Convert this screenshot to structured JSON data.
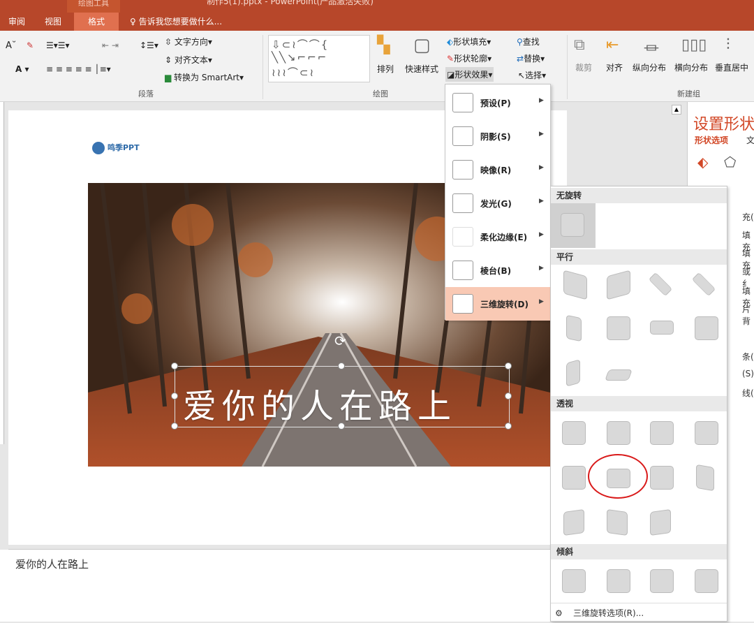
{
  "titlebar": {
    "context_tab": "绘图工具",
    "document": "制作5(1).pptx - PowerPoint(产品激活失败)"
  },
  "tabs": [
    {
      "label": "审阅"
    },
    {
      "label": "视图"
    },
    {
      "label": "格式"
    }
  ],
  "tell_me": "告诉我您想要做什么...",
  "ribbon": {
    "text_direction": "文字方向",
    "align_text": "对齐文本",
    "smartart": "转换为 SmartArt",
    "paragraph_group": "段落",
    "arrange": "排列",
    "quick_styles": "快速样式",
    "shape_fill": "形状填充",
    "shape_outline": "形状轮廓",
    "shape_effects": "形状效果",
    "drawing_group": "绘图",
    "find": "查找",
    "replace": "替换",
    "select": "选择",
    "crop": "裁剪",
    "align": "对齐",
    "dist_v": "纵向分布",
    "dist_h": "横向分布",
    "center_v": "垂直居中",
    "new_group": "新建组"
  },
  "slide": {
    "logo": "鸣季PPT",
    "title": "爱你的人在路上"
  },
  "notes": "爱你的人在路上",
  "format_pane": {
    "title": "设置形状",
    "tab_shape": "形状选项",
    "tab_text": "文",
    "frags": [
      "充(",
      "填充",
      "填充",
      "或纟",
      "填充",
      "片背",
      "条(",
      "(S)",
      "线("
    ]
  },
  "effects_menu": [
    {
      "label": "预设(P)"
    },
    {
      "label": "阴影(S)"
    },
    {
      "label": "映像(R)"
    },
    {
      "label": "发光(G)"
    },
    {
      "label": "柔化边缘(E)"
    },
    {
      "label": "棱台(B)"
    },
    {
      "label": "三维旋转(D)"
    }
  ],
  "rotation_gallery": {
    "sections": [
      "无旋转",
      "平行",
      "透视",
      "倾斜"
    ],
    "options_link": "三维旋转选项(R)..."
  },
  "colors": {
    "accent": "#b7472a",
    "highlight": "#f9c9b4"
  }
}
